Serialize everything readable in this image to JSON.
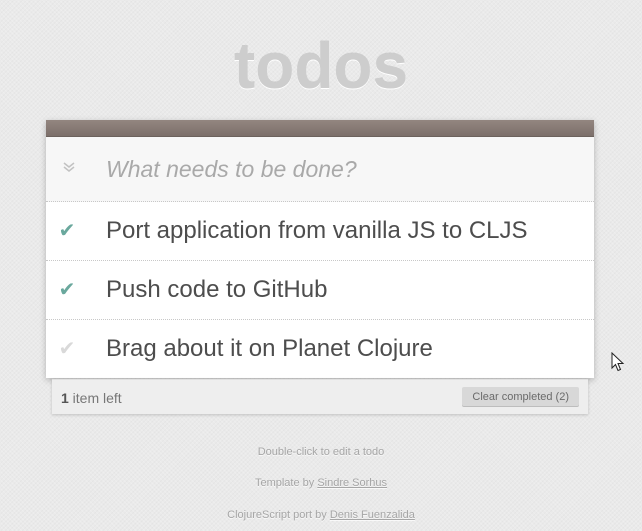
{
  "app": {
    "title": "todos"
  },
  "new_todo": {
    "placeholder": "What needs to be done?",
    "value": "",
    "toggle_all_icon": "double-chevron-down-icon"
  },
  "todos": [
    {
      "label": "Port application from vanilla JS to CLJS",
      "completed": true
    },
    {
      "label": "Push code to GitHub",
      "completed": true
    },
    {
      "label": "Brag about it on Planet Clojure",
      "completed": false
    }
  ],
  "footer": {
    "count_number": "1",
    "count_text": " item left",
    "clear_label": "Clear completed (2)"
  },
  "info": {
    "edit_hint": "Double-click to edit a todo",
    "template_prefix": "Template by ",
    "template_author": "Sindre Sorhus",
    "port_prefix": "ClojureScript port by ",
    "port_author": "Denis Fuenzalida"
  },
  "colors": {
    "header_bar": "#8a7d77",
    "check_done": "#6aa89d",
    "check_open": "#d9d9d9"
  }
}
